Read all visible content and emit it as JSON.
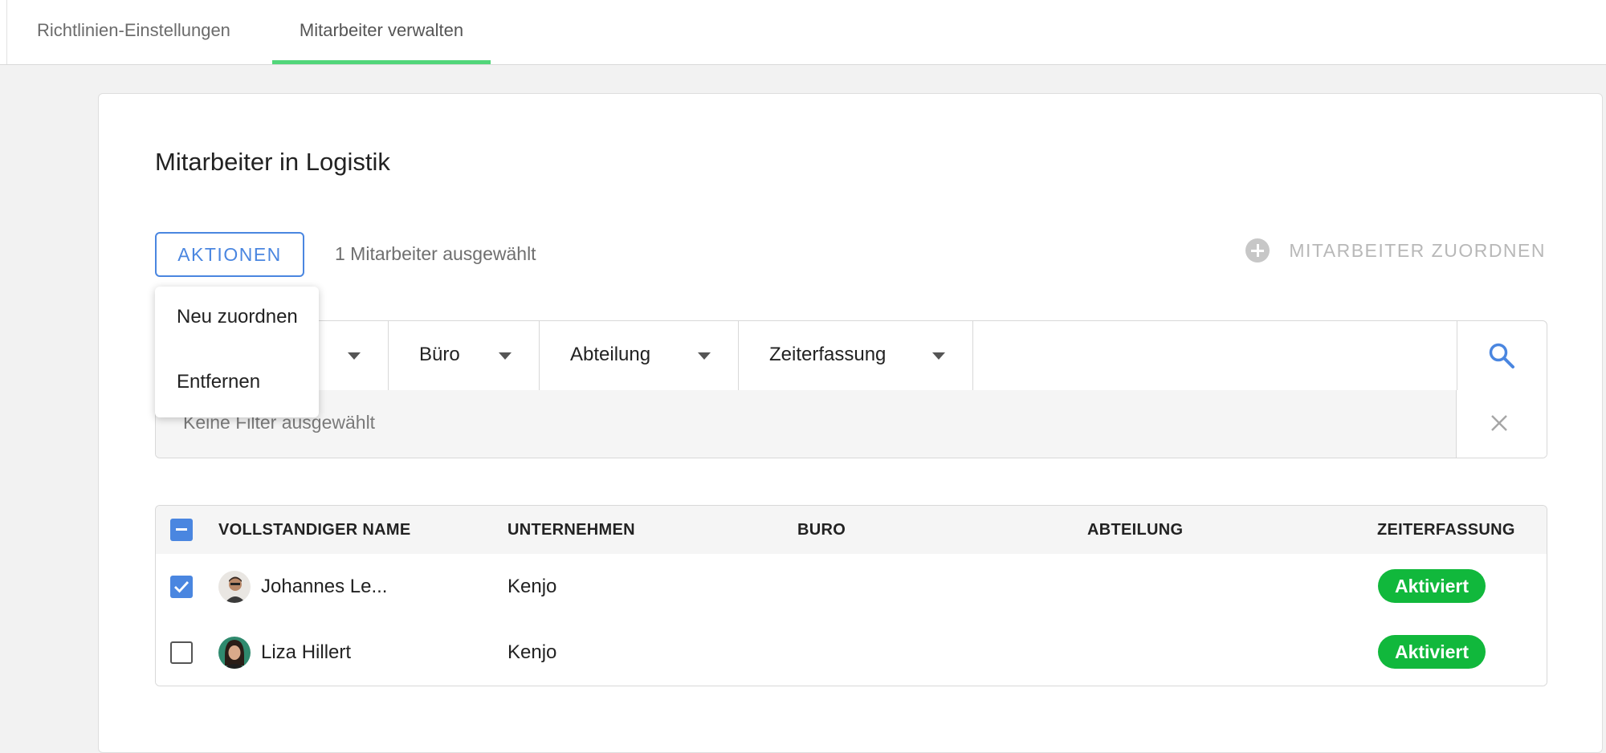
{
  "tabs": [
    {
      "label": "Richtlinien-Einstellungen",
      "active": false
    },
    {
      "label": "Mitarbeiter verwalten",
      "active": true
    }
  ],
  "page_title": "Mitarbeiter in Logistik",
  "toolbar": {
    "actions_label": "AKTIONEN",
    "selected_text": "1 Mitarbeiter ausgewählt",
    "assign_label": "MITARBEITER ZUORDNEN"
  },
  "actions_menu": {
    "items": [
      "Neu zuordnen",
      "Entfernen"
    ]
  },
  "filters": {
    "dropdowns": [
      "Büro",
      "Abteilung",
      "Zeiterfassung"
    ],
    "search_value": "",
    "no_filter_text": "Keine Filter ausgewählt"
  },
  "table": {
    "columns": [
      "VOLLSTANDIGER NAME",
      "UNTERNEHMEN",
      "BURO",
      "ABTEILUNG",
      "ZEITERFASSUNG"
    ],
    "rows": [
      {
        "name": "Johannes Le...",
        "company": "Kenjo",
        "office": "",
        "department": "",
        "status": "Aktiviert",
        "checked": true
      },
      {
        "name": "Liza Hillert",
        "company": "Kenjo",
        "office": "",
        "department": "",
        "status": "Aktiviert",
        "checked": false
      }
    ]
  },
  "colors": {
    "accent": "#4a86e0",
    "tab_underline": "#52d67a",
    "status_green": "#11b83c"
  }
}
